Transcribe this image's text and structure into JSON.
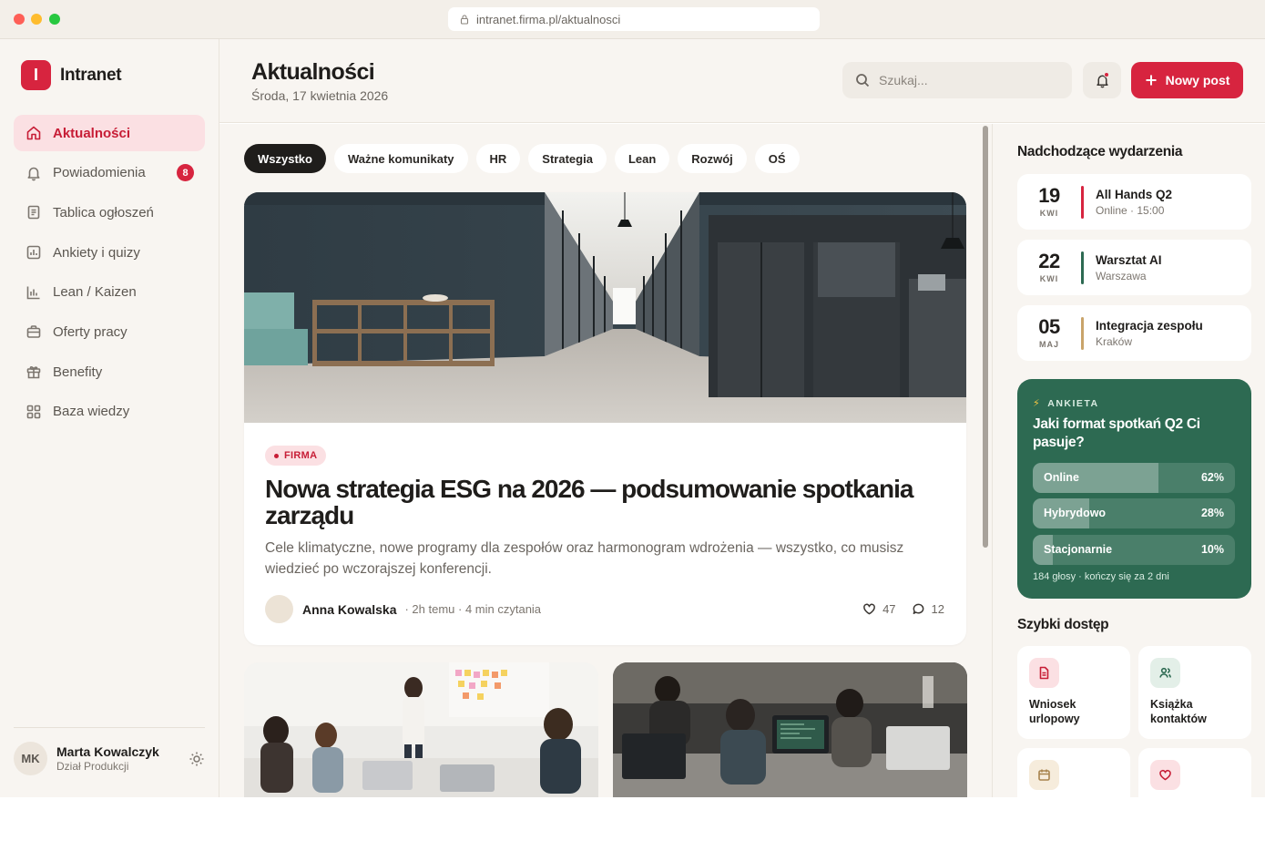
{
  "browser": {
    "url": "intranet.firma.pl/aktualnosci"
  },
  "brand": {
    "logo_letter": "I",
    "name": "Intranet",
    "color": "#d7243f"
  },
  "sidebar": {
    "items": [
      {
        "label": "Aktualności",
        "icon": "home-icon",
        "active": true
      },
      {
        "label": "Powiadomienia",
        "icon": "bell-icon",
        "badge": "8"
      },
      {
        "label": "Tablica ogłoszeń",
        "icon": "clipboard-icon"
      },
      {
        "label": "Ankiety i quizy",
        "icon": "poll-icon"
      },
      {
        "label": "Lean / Kaizen",
        "icon": "bar-chart-icon"
      },
      {
        "label": "Oferty pracy",
        "icon": "briefcase-icon"
      },
      {
        "label": "Benefity",
        "icon": "gift-icon"
      },
      {
        "label": "Baza wiedzy",
        "icon": "grid-icon"
      }
    ],
    "user": {
      "initials": "MK",
      "name": "Marta Kowalczyk",
      "department": "Dział Produkcji"
    }
  },
  "header": {
    "title": "Aktualności",
    "date": "Środa, 17 kwietnia 2026",
    "search_placeholder": "Szukaj...",
    "new_post_label": "Nowy post"
  },
  "filters": [
    "Wszystko",
    "Ważne komunikaty",
    "HR",
    "Strategia",
    "Lean",
    "Rozwój",
    "OŚ"
  ],
  "featured": {
    "tag": "FIRMA",
    "title": "Nowa strategia ESG na 2026 — podsumowanie spotkania zarządu",
    "excerpt": "Cele klimatyczne, nowe programy dla zespołów oraz harmonogram wdrożenia — wszystko, co musisz wiedzieć po wczorajszej konferencji.",
    "author": "Anna Kowalska",
    "meta": "· 2h temu · 4 min czytania",
    "likes": "47",
    "comments": "12"
  },
  "events": {
    "title": "Nadchodzące wydarzenia",
    "items": [
      {
        "day": "19",
        "month": "KWI",
        "title": "All Hands Q2",
        "subtitle": "Online · 15:00",
        "color": "#d7243f"
      },
      {
        "day": "22",
        "month": "KWI",
        "title": "Warsztat AI",
        "subtitle": "Warszawa",
        "color": "#2d6a52"
      },
      {
        "day": "05",
        "month": "MAJ",
        "title": "Integracja zespołu",
        "subtitle": "Kraków",
        "color": "#c9a46a"
      }
    ]
  },
  "poll": {
    "label": "ANKIETA",
    "question": "Jaki format spotkań Q2 Ci pasuje?",
    "options": [
      {
        "label": "Online",
        "percent": "62%",
        "value": 62
      },
      {
        "label": "Hybrydowo",
        "percent": "28%",
        "value": 28
      },
      {
        "label": "Stacjonarnie",
        "percent": "10%",
        "value": 10
      }
    ],
    "footer": "184 głosy · kończy się za 2 dni",
    "color": "#2d6a52"
  },
  "quick_access": {
    "title": "Szybki dostęp",
    "items": [
      {
        "label": "Wniosek urlopowy",
        "icon": "document-icon"
      },
      {
        "label": "Książka kontaktów",
        "icon": "contacts-icon"
      },
      {
        "label": "",
        "icon": "calendar-icon"
      },
      {
        "label": "",
        "icon": "heart-icon"
      }
    ]
  }
}
